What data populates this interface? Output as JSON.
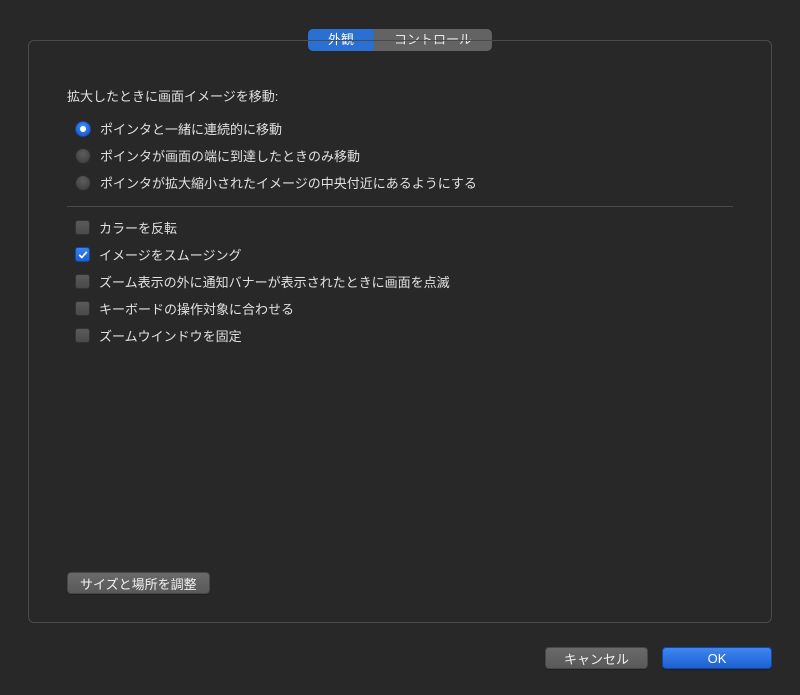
{
  "tabs": {
    "appearance": "外観",
    "controls": "コントロール"
  },
  "heading": "拡大したときに画面イメージを移動:",
  "radios": {
    "continuous": "ポインタと一緒に連続的に移動",
    "edge": "ポインタが画面の端に到達したときのみ移動",
    "center": "ポインタが拡大縮小されたイメージの中央付近にあるようにする"
  },
  "checkboxes": {
    "invert_colors": "カラーを反転",
    "smooth_images": "イメージをスムージング",
    "flash_notifications": "ズーム表示の外に通知バナーが表示されたときに画面を点滅",
    "follow_keyboard": "キーボードの操作対象に合わせる",
    "lock_zoom_window": "ズームウインドウを固定"
  },
  "buttons": {
    "adjust_size": "サイズと場所を調整",
    "cancel": "キャンセル",
    "ok": "OK"
  },
  "state": {
    "active_tab": "appearance",
    "radio_selected": "continuous",
    "checks": {
      "invert_colors": false,
      "smooth_images": true,
      "flash_notifications": false,
      "follow_keyboard": false,
      "lock_zoom_window": false
    }
  }
}
